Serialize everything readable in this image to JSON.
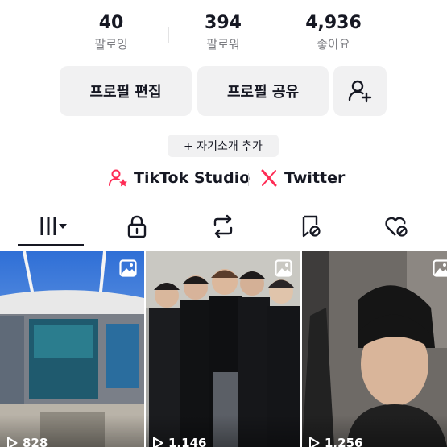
{
  "stats": [
    {
      "value": "40",
      "label": "팔로잉"
    },
    {
      "value": "394",
      "label": "팔로워"
    },
    {
      "value": "4,936",
      "label": "좋아요"
    }
  ],
  "actions": {
    "edit_profile": "프로필 편집",
    "share_profile": "프로필 공유",
    "add_friend_icon": "person-plus-icon"
  },
  "bio_button": "+ 자기소개 추가",
  "links": {
    "tiktok_studio": "TikTok Studio",
    "twitter": "Twitter"
  },
  "tabs": [
    {
      "icon": "videos-grid-icon",
      "active": true
    },
    {
      "icon": "lock-icon",
      "active": false
    },
    {
      "icon": "repost-icon",
      "active": false
    },
    {
      "icon": "favorites-icon",
      "active": false
    },
    {
      "icon": "liked-icon",
      "active": false
    }
  ],
  "videos": [
    {
      "views": "828",
      "thumbnail": "stadium-with-banner"
    },
    {
      "views": "1,146",
      "thumbnail": "group-photo"
    },
    {
      "views": "1,256",
      "thumbnail": "person-closeup"
    }
  ],
  "colors": {
    "text_primary": "#161823",
    "text_secondary": "#7a7b80",
    "button_bg": "#f1f1f2",
    "accent_pink": "#fe2c55"
  }
}
